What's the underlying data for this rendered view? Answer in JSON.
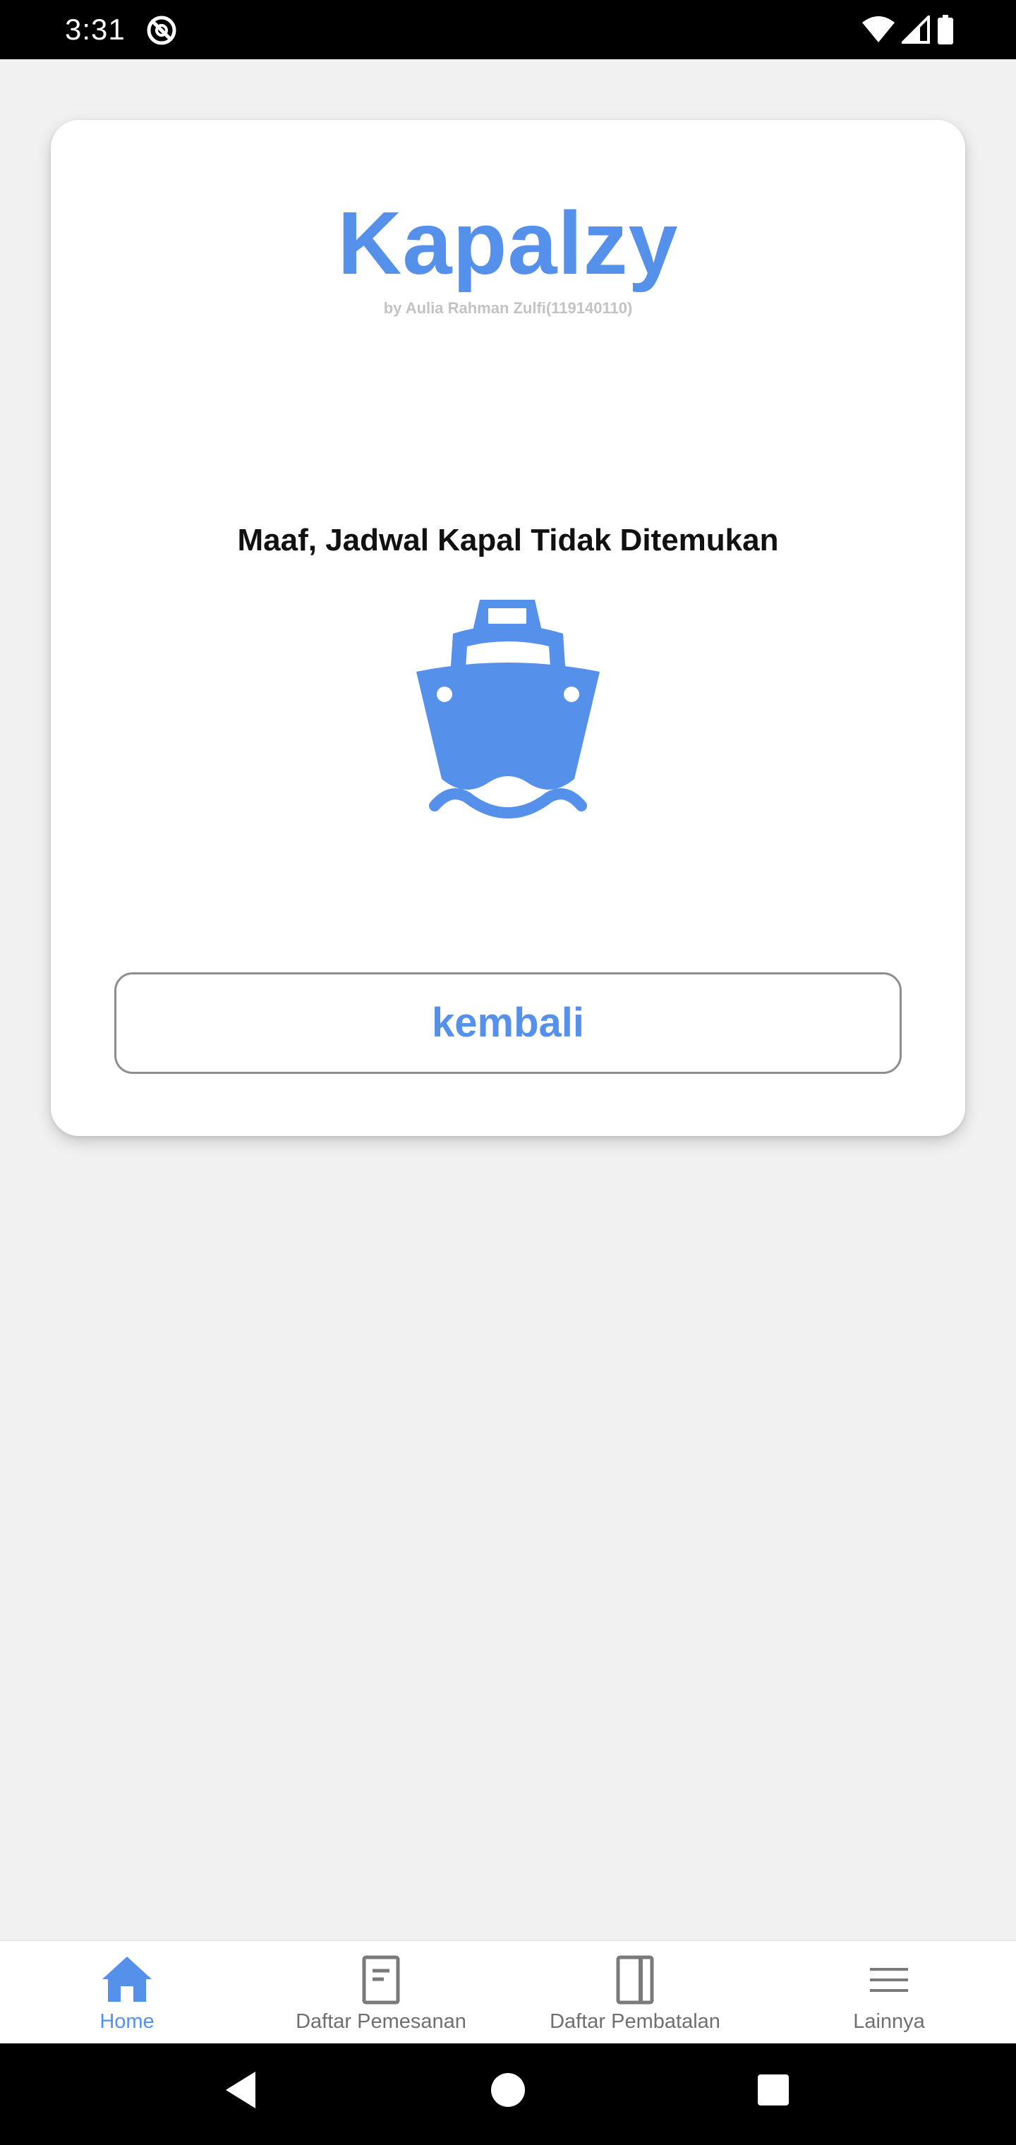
{
  "status_bar": {
    "time": "3:31",
    "app_icon": "do-not-disturb-icon",
    "icons": [
      "wifi-icon",
      "cellular-signal-icon",
      "battery-icon"
    ]
  },
  "card": {
    "title": "Kapalzy",
    "subtitle": "by Aulia Rahman Zulfi(119140110)",
    "message": "Maaf, Jadwal Kapal Tidak Ditemukan",
    "illustration": "ship-icon",
    "back_button_label": "kembali"
  },
  "bottom_nav": {
    "items": [
      {
        "label": "Home",
        "icon": "home-icon",
        "active": true
      },
      {
        "label": "Daftar Pemesanan",
        "icon": "document-icon",
        "active": false
      },
      {
        "label": "Daftar Pembatalan",
        "icon": "book-icon",
        "active": false
      },
      {
        "label": "Lainnya",
        "icon": "menu-icon",
        "active": false
      }
    ]
  },
  "system_nav": {
    "buttons": [
      "back-icon",
      "home-circle-icon",
      "recents-icon"
    ]
  },
  "colors": {
    "accent": "#5590ea",
    "subtitle": "#c3c3c3",
    "background": "#f1f1f1"
  }
}
